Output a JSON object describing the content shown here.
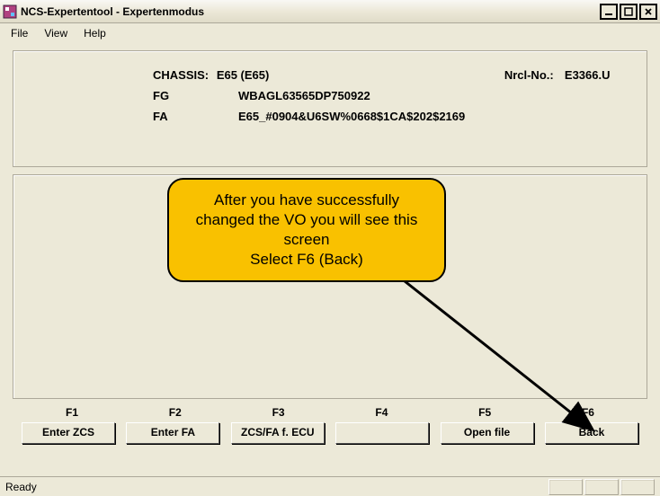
{
  "window": {
    "title": "NCS-Expertentool - Expertenmodus"
  },
  "menu": {
    "file": "File",
    "view": "View",
    "help": "Help"
  },
  "info": {
    "chassis_label": "CHASSIS:",
    "chassis_value": "E65 (E65)",
    "nrcl_label": "Nrcl-No.:",
    "nrcl_value": "E3366.U",
    "fg_label": "FG",
    "fg_value": "WBAGL63565DP750922",
    "fa_label": "FA",
    "fa_value": "E65_#0904&U6SW%0668$1CA$202$2169"
  },
  "fkeys": {
    "f1": {
      "key": "F1",
      "label": "Enter ZCS"
    },
    "f2": {
      "key": "F2",
      "label": "Enter FA"
    },
    "f3": {
      "key": "F3",
      "label": "ZCS/FA f. ECU"
    },
    "f4": {
      "key": "F4",
      "label": ""
    },
    "f5": {
      "key": "F5",
      "label": "Open file"
    },
    "f6": {
      "key": "F6",
      "label": "Back"
    }
  },
  "status": {
    "text": "Ready"
  },
  "callout": {
    "line1": "After you have successfully",
    "line2": "changed the VO you will see this",
    "line3": "screen",
    "line4": "Select F6 (Back)"
  }
}
